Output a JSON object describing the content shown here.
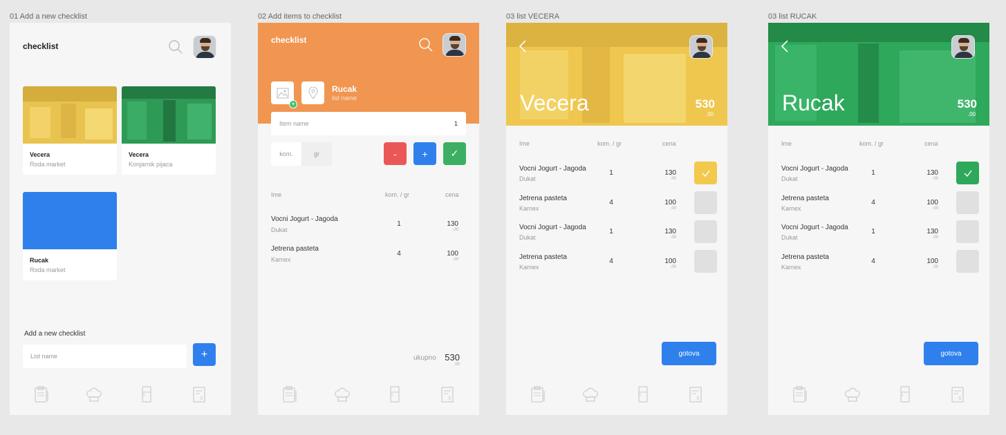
{
  "artboards": [
    {
      "label": "01 Add a new checklist"
    },
    {
      "label": "02 Add items to checklist"
    },
    {
      "label": "03 list VECERA"
    },
    {
      "label": "03 list RUCAK"
    }
  ],
  "screen1": {
    "title": "checklist",
    "cards": [
      {
        "name": "Vecera",
        "sub": "Roda market",
        "color": "#f2c94c"
      },
      {
        "name": "Vecera",
        "sub": "Konjarnik pijaca",
        "color": "#27ae60"
      },
      {
        "name": "Rucak",
        "sub": "Roda market",
        "color": "#2f80ed"
      }
    ],
    "add_label": "Add a new checklist",
    "list_placeholder": "List name",
    "add_button": "+"
  },
  "screen2": {
    "title": "checklist",
    "list_title": "Rucak",
    "list_subtitle": "list name",
    "item_placeholder": "Item name",
    "item_qty": "1",
    "unit_options": [
      "kom.",
      "gr"
    ],
    "minus": "-",
    "plus": "+",
    "check": "✓",
    "headers": {
      "name": "Ime",
      "qty": "kom. / gr",
      "price": "cena"
    },
    "rows": [
      {
        "name": "Vocni Jogurt - Jagoda",
        "brand": "Dukat",
        "qty": "1",
        "price": "130",
        "cents": ".00"
      },
      {
        "name": "Jetrena pasteta",
        "brand": "Karnex",
        "qty": "4",
        "price": "100",
        "cents": ".00"
      }
    ],
    "total_label": "ukupno",
    "total": "530",
    "total_cents": ".00"
  },
  "screen3": {
    "title": "Vecera",
    "total": "530",
    "total_cents": ".00",
    "accent": "#f2c94c",
    "headers": {
      "name": "Ime",
      "qty": "kom. / gr",
      "price": "cena"
    },
    "rows": [
      {
        "name": "Vocni Jogurt - Jagoda",
        "brand": "Dukat",
        "qty": "1",
        "price": "130",
        "cents": ".00",
        "checked": true
      },
      {
        "name": "Jetrena pasteta",
        "brand": "Karnex",
        "qty": "4",
        "price": "100",
        "cents": ".00",
        "checked": false
      },
      {
        "name": "Vocni Jogurt - Jagoda",
        "brand": "Dukat",
        "qty": "1",
        "price": "130",
        "cents": ".00",
        "checked": false
      },
      {
        "name": "Jetrena pasteta",
        "brand": "Karnex",
        "qty": "4",
        "price": "100",
        "cents": ".00",
        "checked": false
      }
    ],
    "done_button": "gotova"
  },
  "screen4": {
    "title": "Rucak",
    "total": "530",
    "total_cents": ".00",
    "accent": "#27ae60",
    "headers": {
      "name": "Ime",
      "qty": "kom. / gr",
      "price": "cena"
    },
    "rows": [
      {
        "name": "Vocni Jogurt - Jagoda",
        "brand": "Dukat",
        "qty": "1",
        "price": "130",
        "cents": ".00",
        "checked": true
      },
      {
        "name": "Jetrena pasteta",
        "brand": "Karnex",
        "qty": "4",
        "price": "100",
        "cents": ".00",
        "checked": false
      },
      {
        "name": "Vocni Jogurt - Jagoda",
        "brand": "Dukat",
        "qty": "1",
        "price": "130",
        "cents": ".00",
        "checked": false
      },
      {
        "name": "Jetrena pasteta",
        "brand": "Karnex",
        "qty": "4",
        "price": "100",
        "cents": ".00",
        "checked": false
      }
    ],
    "done_button": "gotova"
  },
  "icons": {
    "nav": [
      "checklist-icon",
      "chef-hat-icon",
      "fridge-icon",
      "receipt-icon"
    ]
  }
}
